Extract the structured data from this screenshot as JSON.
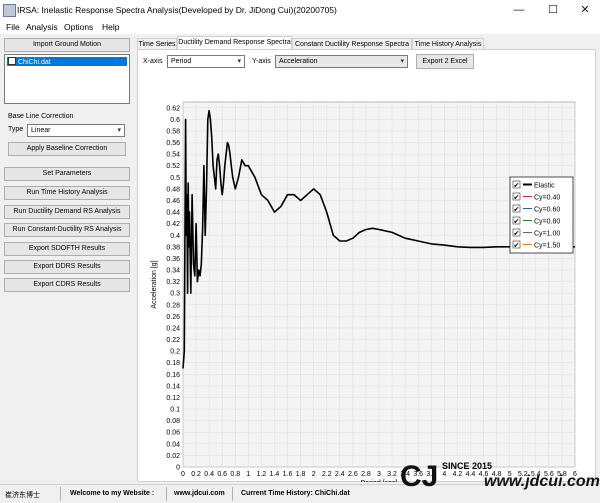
{
  "window": {
    "title": "IRSA: Inelastic Response Spectra Analysis(Developed by Dr. JiDong Cui)(20200705)",
    "minimize": "—",
    "maximize": "☐",
    "close": "✕"
  },
  "menu": [
    "File",
    "Analysis",
    "Options",
    "Help"
  ],
  "left": {
    "import_button": "Import Ground Motion",
    "file_item": "ChiChi.dat",
    "baseline_label": "Base Line Correction",
    "type_label": "Type",
    "type_value": "Linear",
    "apply_baseline": "Apply Baseline Correction",
    "set_parameters": "Set Parameters",
    "run_time_history": "Run Time History Analysis",
    "run_ductility_demand": "Run Ductility Demand RS Analysis",
    "run_constant_ductility": "Run Constant-Ductility RS Analysis",
    "export_sdofth": "Export SDOFTH Results",
    "export_ddrs": "Export DDRS Results",
    "export_cdrs": "Export CDRS Results"
  },
  "tabs": [
    "Time Series",
    "Ductility Demand Response Spectra",
    "Constant Ductility Response Spectra",
    "Time History Analysis"
  ],
  "toolbar": {
    "xaxis_label": "X-axis",
    "xaxis_value": "Period",
    "yaxis_label": "Y-axis",
    "yaxis_value": "Acceleration",
    "export_button": "Export 2 Excel"
  },
  "status": {
    "logo_text": "崔济东博士",
    "welcome": "Welcome to my Website :",
    "website": "www.jdcui.com",
    "current_label": "Current Time History: ChiChi.dat"
  },
  "watermark": {
    "since": "SINCE 2015",
    "url": "www.jdcui.com"
  },
  "chart_data": {
    "type": "line",
    "xlabel": "Period [sec]",
    "ylabel": "Acceleration [g]",
    "xlim": [
      0,
      6
    ],
    "ylim": [
      0,
      0.63
    ],
    "x_ticks": [
      "0",
      "0.2",
      "0.4",
      "0.6",
      "0.8",
      "1",
      "1.2",
      "1.4",
      "1.6",
      "1.8",
      "2",
      "2.2",
      "2.4",
      "2.6",
      "2.8",
      "3",
      "3.2",
      "3.4",
      "3.6",
      "3.8",
      "4",
      "4.2",
      "4.4",
      "4.6",
      "4.8",
      "5",
      "5.2",
      "5.4",
      "5.6",
      "5.8",
      "6"
    ],
    "y_ticks": [
      "0",
      "0.02",
      "0.04",
      "0.06",
      "0.08",
      "0.1",
      "0.12",
      "0.14",
      "0.16",
      "0.18",
      "0.2",
      "0.22",
      "0.24",
      "0.26",
      "0.28",
      "0.3",
      "0.32",
      "0.34",
      "0.36",
      "0.38",
      "0.4",
      "0.42",
      "0.44",
      "0.46",
      "0.48",
      "0.5",
      "0.52",
      "0.54",
      "0.56",
      "0.58",
      "0.6",
      "0.62"
    ],
    "grid": true,
    "legend_position": "top-right",
    "series": [
      {
        "name": "Elastic",
        "color": "#000000",
        "checked": true,
        "x": [
          0.0,
          0.02,
          0.04,
          0.05,
          0.06,
          0.07,
          0.08,
          0.09,
          0.1,
          0.12,
          0.14,
          0.16,
          0.18,
          0.2,
          0.22,
          0.24,
          0.26,
          0.28,
          0.3,
          0.32,
          0.34,
          0.36,
          0.38,
          0.4,
          0.42,
          0.44,
          0.46,
          0.48,
          0.5,
          0.52,
          0.54,
          0.56,
          0.58,
          0.6,
          0.62,
          0.64,
          0.66,
          0.68,
          0.7,
          0.72,
          0.74,
          0.76,
          0.78,
          0.8,
          0.85,
          0.9,
          0.95,
          1.0,
          1.1,
          1.2,
          1.3,
          1.4,
          1.5,
          1.6,
          1.7,
          1.8,
          1.9,
          2.0,
          2.1,
          2.2,
          2.3,
          2.4,
          2.5,
          2.6,
          2.7,
          2.8,
          2.9,
          3.0,
          3.2,
          3.4,
          3.6,
          3.8,
          4.0,
          4.2,
          4.4,
          4.6,
          4.8,
          5.0,
          5.2,
          5.4,
          5.6,
          5.8,
          6.0
        ],
        "y": [
          0.17,
          0.2,
          0.6,
          0.4,
          0.47,
          0.3,
          0.49,
          0.38,
          0.44,
          0.3,
          0.47,
          0.35,
          0.33,
          0.42,
          0.32,
          0.34,
          0.33,
          0.35,
          0.41,
          0.52,
          0.4,
          0.48,
          0.6,
          0.615,
          0.6,
          0.57,
          0.52,
          0.5,
          0.48,
          0.53,
          0.54,
          0.52,
          0.49,
          0.47,
          0.49,
          0.52,
          0.54,
          0.56,
          0.555,
          0.54,
          0.52,
          0.5,
          0.49,
          0.48,
          0.5,
          0.53,
          0.52,
          0.52,
          0.5,
          0.47,
          0.46,
          0.44,
          0.45,
          0.47,
          0.47,
          0.46,
          0.47,
          0.48,
          0.47,
          0.44,
          0.4,
          0.39,
          0.39,
          0.395,
          0.405,
          0.41,
          0.412,
          0.41,
          0.405,
          0.395,
          0.39,
          0.385,
          0.383,
          0.38,
          0.379,
          0.379,
          0.38,
          0.38,
          0.381,
          0.381,
          0.38,
          0.38,
          0.38
        ]
      },
      {
        "name": "Cy=0.40",
        "color": "#c0392b",
        "checked": true
      },
      {
        "name": "Cy=0.60",
        "color": "#1f5fbf",
        "checked": true
      },
      {
        "name": "Cy=0.80",
        "color": "#2e7d32",
        "checked": true
      },
      {
        "name": "Cy=1.00",
        "color": "#8e44ad",
        "checked": true
      },
      {
        "name": "Cy=1.50",
        "color": "#e67e22",
        "checked": true
      }
    ]
  }
}
